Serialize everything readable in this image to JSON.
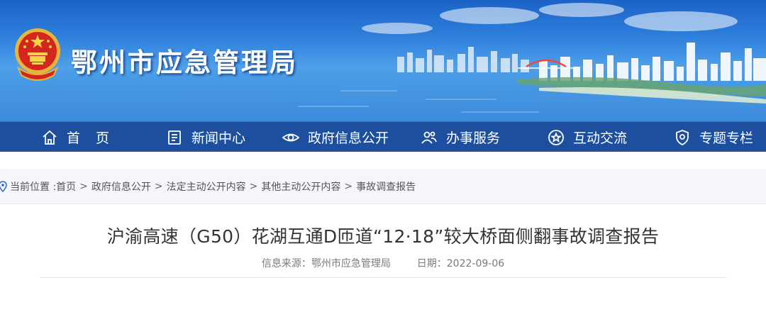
{
  "header": {
    "site_title": "鄂州市应急管理局",
    "emblem_icon": "national-emblem-icon"
  },
  "nav": {
    "items": [
      {
        "label": "首页",
        "icon": "home-icon"
      },
      {
        "label": "新闻中心",
        "icon": "newspaper-icon"
      },
      {
        "label": "政府信息公开",
        "icon": "eye-icon"
      },
      {
        "label": "办事服务",
        "icon": "people-icon"
      },
      {
        "label": "互动交流",
        "icon": "star-circle-icon"
      },
      {
        "label": "专题专栏",
        "icon": "shield-icon"
      }
    ]
  },
  "breadcrumb": {
    "prefix": "当前位置 :",
    "items": [
      "首页",
      "政府信息公开",
      "法定主动公开内容",
      "其他主动公开内容",
      "事故调查报告"
    ],
    "separator": ">"
  },
  "article": {
    "title": "沪渝高速（G50）花湖互通D匝道“12·18”较大桥面侧翻事故调查报告",
    "source_label": "信息来源：",
    "source": "鄂州市应急管理局",
    "date_label": "日期：",
    "date": "2022-09-06"
  },
  "colors": {
    "nav_bg": "#1d4f9e",
    "banner_top": "#1b63c6",
    "title_text": "#333333",
    "meta_text": "#7a7a7a"
  }
}
